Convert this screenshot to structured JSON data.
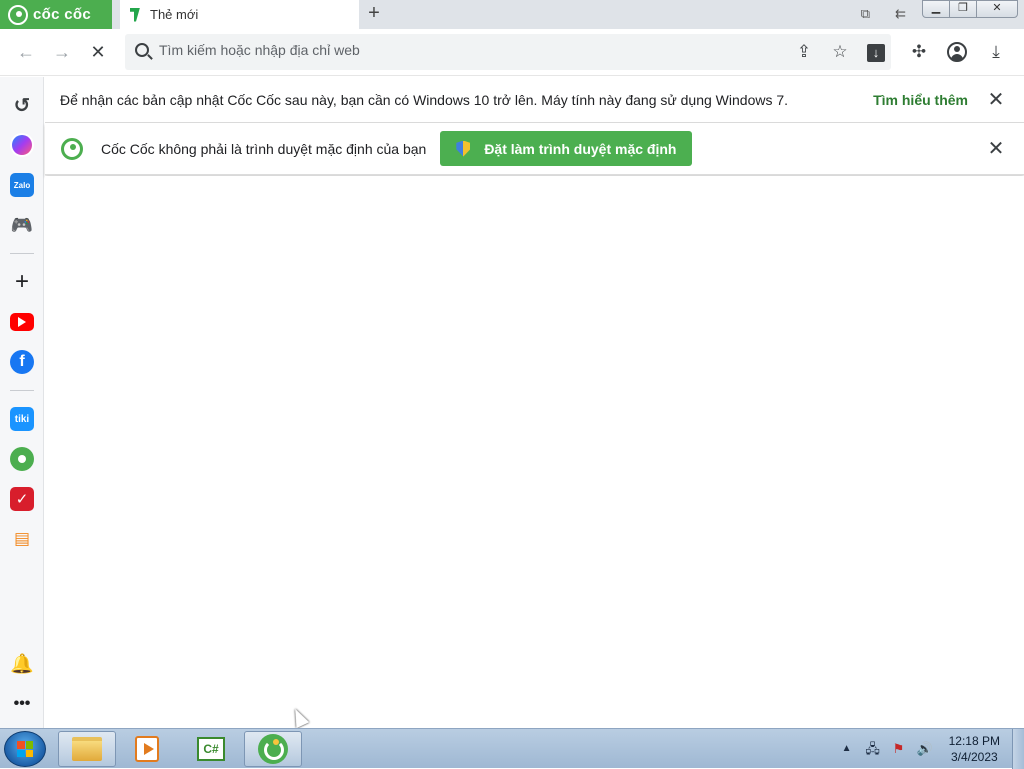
{
  "browser": {
    "brand": "cốc cốc",
    "tab_title": "Thẻ mới",
    "new_tab": "+",
    "accent": "#4cae4f"
  },
  "toolbar": {
    "back": "←",
    "forward": "→",
    "reload_stop": "✕",
    "search_placeholder": "Tìm kiếm hoặc nhập địa chỉ web",
    "icons": [
      "share-icon",
      "star-icon",
      "download-to-device-icon",
      "extensions-icon",
      "profile-icon",
      "downloads-icon"
    ]
  },
  "sidebar": {
    "items": [
      "history-icon",
      "messenger-icon",
      "zalo-icon",
      "games-icon",
      "add-icon",
      "youtube-icon",
      "facebook-icon",
      "tiki-icon",
      "football-icon",
      "checklist-icon",
      "shop-icon",
      "bell-icon",
      "more-icon"
    ],
    "zalo_label": "Zalo",
    "tiki_label": "tiki"
  },
  "infobar_update": {
    "message": "Để nhận các bản cập nhật Cốc Cốc sau này, bạn cần có Windows 10 trở lên. Máy tính này đang sử dụng Windows 7.",
    "link": "Tìm hiểu thêm"
  },
  "infobar_default": {
    "message": "Cốc Cốc không phải là trình duyệt mặc định của bạn",
    "button": "Đặt làm trình duyệt mặc định"
  },
  "taskbar": {
    "time": "12:18 PM",
    "date": "3/4/2023",
    "csharp_label": "C#",
    "apps": [
      "file-explorer-icon",
      "media-player-icon",
      "csharp-icon",
      "coccoc-icon"
    ]
  }
}
